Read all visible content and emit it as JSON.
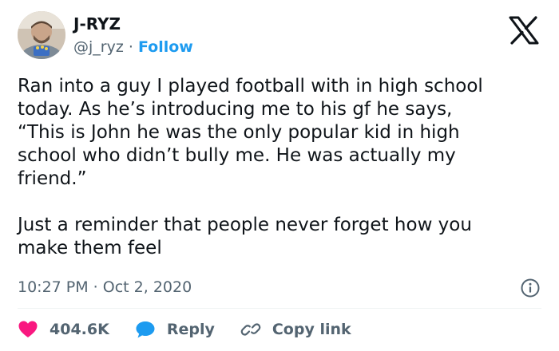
{
  "user": {
    "name": "J-RYZ",
    "handle": "@j_ryz",
    "separator": "·",
    "follow_label": "Follow"
  },
  "tweet": {
    "text": "Ran into a guy I played football with in high school\ntoday. As he’s introducing me to his gf he says,\n“This is John he was the only popular kid in high\nschool who didn’t bully me. He was actually my\nfriend.”\n\nJust a reminder that people never forget how you\nmake them feel",
    "timestamp": "10:27 PM · Oct 2, 2020"
  },
  "actions": {
    "likes": "404.6K",
    "reply_label": "Reply",
    "copy_link_label": "Copy link"
  },
  "icons": {
    "logo": "x-logo-icon",
    "info": "info-icon",
    "like": "heart-icon",
    "reply": "speech-bubble-icon",
    "copy": "link-icon"
  },
  "colors": {
    "like": "#f91880",
    "reply": "#1d9bf0",
    "follow": "#1d9bf0",
    "secondary_text": "#536471"
  }
}
